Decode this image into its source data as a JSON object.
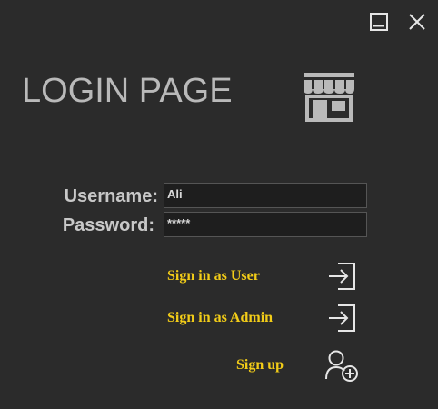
{
  "window": {
    "minimize_icon": "minimize-icon",
    "close_icon": "close-icon"
  },
  "header": {
    "title": "LOGIN PAGE",
    "icon": "store-icon"
  },
  "form": {
    "username_label": "Username:",
    "username_value": "Ali",
    "password_label": "Password:",
    "password_value": "*****"
  },
  "actions": {
    "sign_in_user": "Sign in as User",
    "sign_in_admin": "Sign in as Admin",
    "sign_up": "Sign up",
    "sign_in_icon": "sign-in-icon",
    "add_user_icon": "add-user-icon"
  },
  "colors": {
    "background": "#2b2b2b",
    "title": "#b9b9b9",
    "label": "#c8c8c8",
    "accent": "#f2cc18"
  }
}
